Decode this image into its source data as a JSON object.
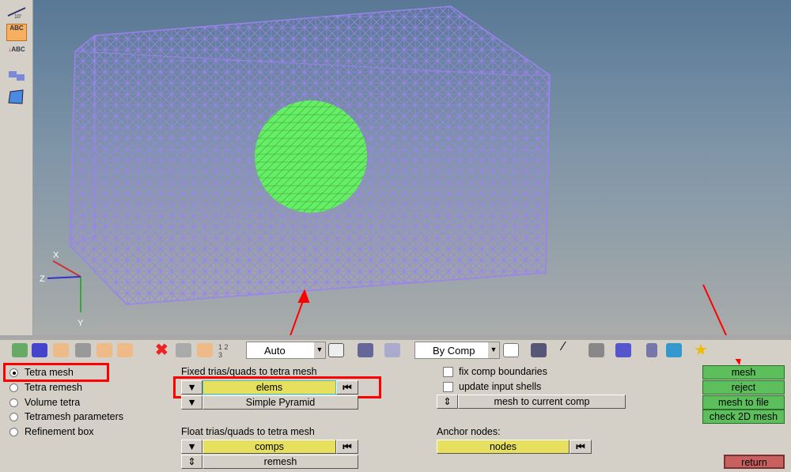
{
  "sidebar": {
    "icons": [
      "ruler-scale-icon",
      "text-abc-icon",
      "node-label-abc-icon",
      "reverse-normals-icon",
      "surface-patch-icon"
    ],
    "scale_label": "10'",
    "abc_label": "ABC"
  },
  "viewport": {
    "axis_labels": {
      "x": "X",
      "y": "Y",
      "z": "Z"
    },
    "mesh_color": "#9b82ee",
    "sphere_color": "#66ee66"
  },
  "toolbar": {
    "render_mode": "Auto",
    "color_mode": "By Comp"
  },
  "panel": {
    "radios": [
      {
        "label": "Tetra mesh",
        "selected": true
      },
      {
        "label": "Tetra remesh",
        "selected": false
      },
      {
        "label": "Volume tetra",
        "selected": false
      },
      {
        "label": "Tetramesh parameters",
        "selected": false
      },
      {
        "label": "Refinement box",
        "selected": false
      }
    ],
    "fixed_label": "Fixed trias/quads to tetra mesh",
    "fixed_selector": "elems",
    "fixed_type": "Simple Pyramid",
    "float_label": "Float trias/quads to tetra mesh",
    "float_selector": "comps",
    "float_option": "remesh",
    "fix_comp_boundaries": {
      "label": "fix comp boundaries",
      "checked": false
    },
    "update_input_shells": {
      "label": "update input shells",
      "checked": false
    },
    "mesh_dest": "mesh to current comp",
    "anchor_label": "Anchor nodes:",
    "anchor_selector": "nodes",
    "actions": {
      "mesh": "mesh",
      "reject": "reject",
      "mesh_to_file": "mesh to file",
      "check_2d": "check 2D mesh",
      "return": "return"
    }
  }
}
